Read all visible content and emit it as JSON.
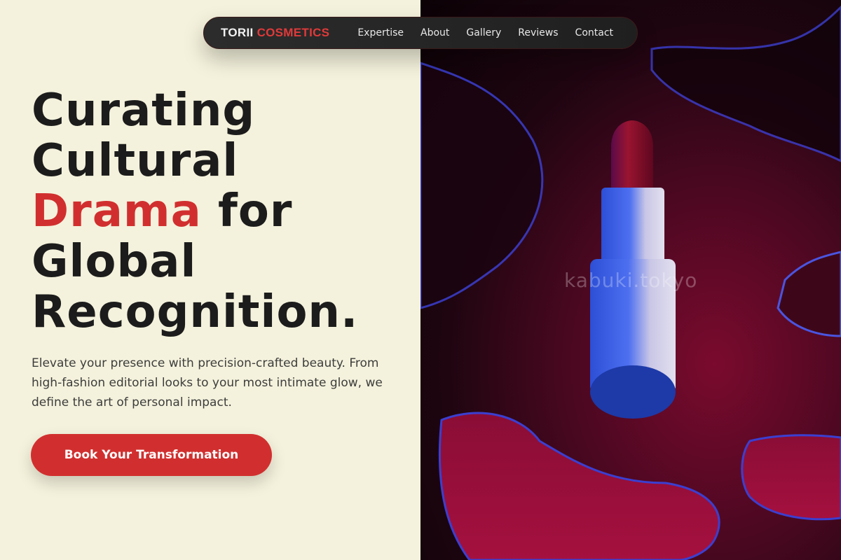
{
  "nav": {
    "brand_part1": "TORII",
    "brand_part2": "COSMETICS",
    "links": [
      "Expertise",
      "About",
      "Gallery",
      "Reviews",
      "Contact"
    ]
  },
  "hero": {
    "line1": "Curating",
    "line2": "Cultural",
    "line3_accent": "Drama",
    "line3_rest": " for",
    "line4": "Global",
    "line5": "Recognition.",
    "subtitle": "Elevate your presence with precision-crafted beauty. From high-fashion editorial looks to your most intimate glow, we define the art of personal impact.",
    "cta_label": "Book Your Transformation"
  },
  "image": {
    "watermark": "kabuki.tokyo"
  },
  "colors": {
    "accent": "#d12f2f",
    "background": "#f4f2dc",
    "nav_bg": "#262626",
    "text": "#1c1c1c"
  }
}
